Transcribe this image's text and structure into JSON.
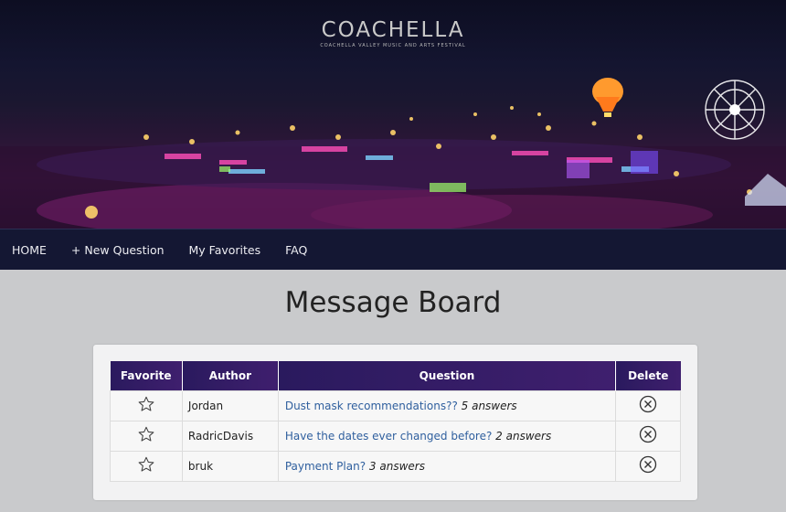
{
  "brand": {
    "logo_text": "COACHELLA",
    "tagline": "COACHELLA VALLEY MUSIC AND ARTS FESTIVAL"
  },
  "nav": {
    "items": [
      "HOME",
      "+ New Question",
      "My Favorites",
      "FAQ"
    ]
  },
  "page": {
    "title": "Message Board"
  },
  "table": {
    "headers": [
      "Favorite",
      "Author",
      "Question",
      "Delete"
    ],
    "rows": [
      {
        "author": "Jordan",
        "question": "Dust mask recommendations??",
        "answers": "5 answers",
        "favorite_icon": "star-outline-icon",
        "delete_icon": "circle-x-icon"
      },
      {
        "author": "RadricDavis",
        "question": "Have the dates ever changed before?",
        "answers": "2 answers",
        "favorite_icon": "star-outline-icon",
        "delete_icon": "circle-x-icon"
      },
      {
        "author": "bruk",
        "question": "Payment Plan?",
        "answers": "3 answers",
        "favorite_icon": "star-outline-icon",
        "delete_icon": "circle-x-icon"
      }
    ]
  },
  "colors": {
    "nav_bg": "#141733",
    "header_purple": "#3a1d6a",
    "link_blue": "#2f5f9e",
    "page_bg": "#c9cacc"
  }
}
